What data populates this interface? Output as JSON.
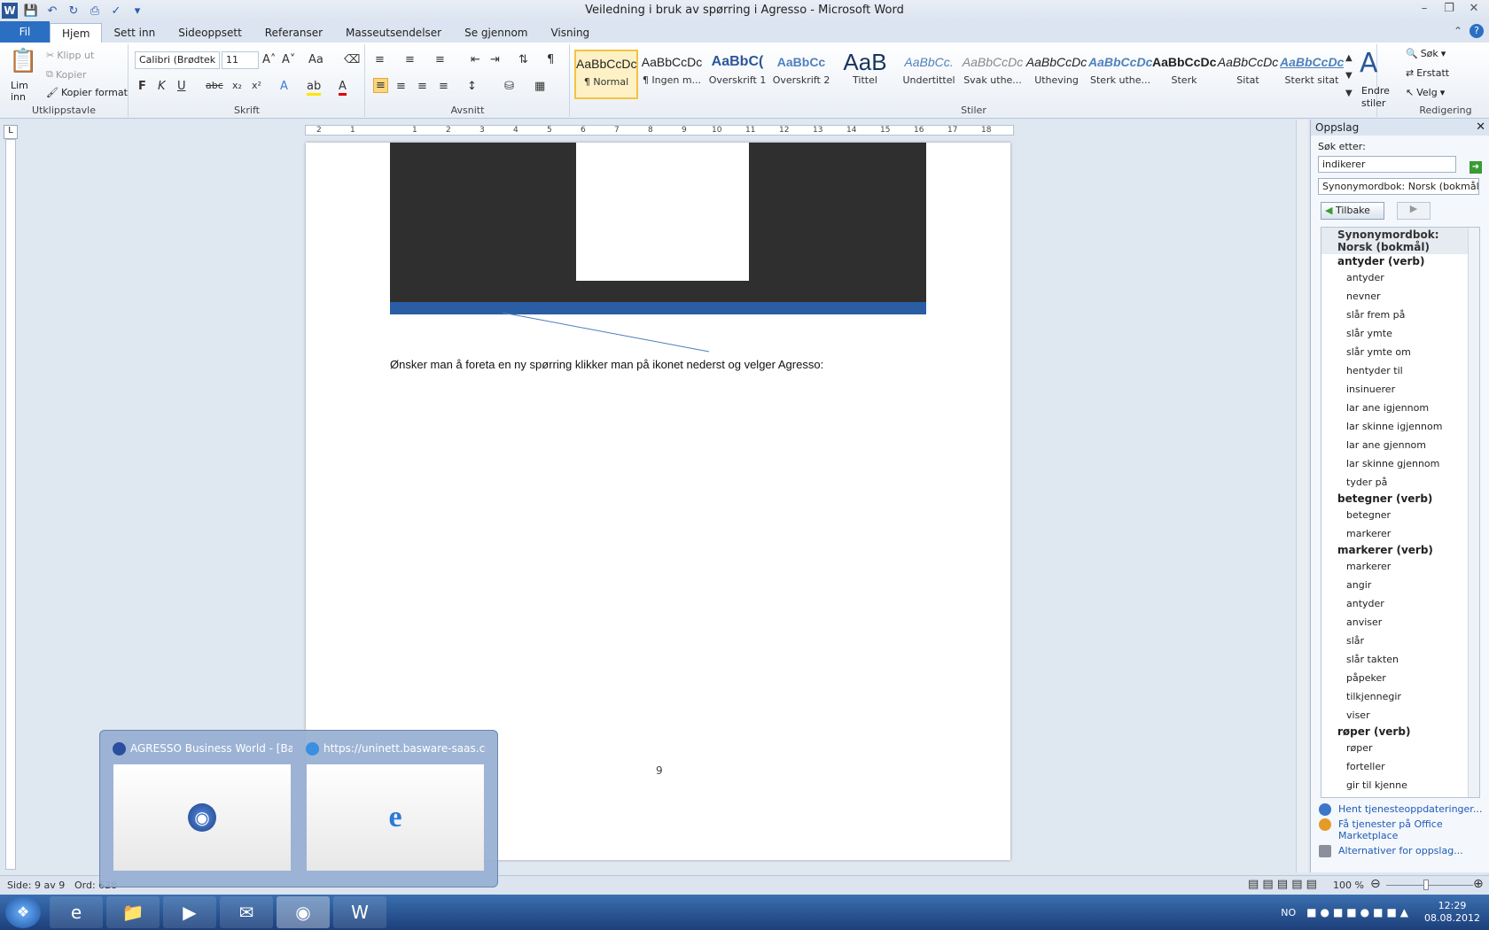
{
  "window": {
    "title": "Veiledning i bruk av spørring i Agresso  -  Microsoft Word",
    "logo": "W"
  },
  "tabs": [
    "Fil",
    "Hjem",
    "Sett inn",
    "Sideoppsett",
    "Referanser",
    "Masseutsendelser",
    "Se gjennom",
    "Visning"
  ],
  "ribbon": {
    "clipboard": {
      "label": "Utklippstavle",
      "paste": "Lim",
      "paste2": "inn",
      "cut": "Klipp ut",
      "copy": "Kopier",
      "format_painter": "Kopier format"
    },
    "font": {
      "label": "Skrift",
      "family": "Calibri (Brødtek",
      "size": "11"
    },
    "paragraph": {
      "label": "Avsnitt"
    },
    "styles": {
      "label": "Stiler",
      "items": [
        {
          "sample": "AaBbCcDc",
          "name": "¶ Normal"
        },
        {
          "sample": "AaBbCcDc",
          "name": "¶ Ingen m..."
        },
        {
          "sample": "AaBbC(",
          "name": "Overskrift 1"
        },
        {
          "sample": "AaBbCc",
          "name": "Overskrift 2"
        },
        {
          "sample": "AaB",
          "name": "Tittel"
        },
        {
          "sample": "AaBbCc.",
          "name": "Undertittel"
        },
        {
          "sample": "AaBbCcDc",
          "name": "Svak uthe..."
        },
        {
          "sample": "AaBbCcDc",
          "name": "Utheving"
        },
        {
          "sample": "AaBbCcDc",
          "name": "Sterk uthe..."
        },
        {
          "sample": "AaBbCcDc",
          "name": "Sterk"
        },
        {
          "sample": "AaBbCcDc",
          "name": "Sitat"
        },
        {
          "sample": "AaBbCcDc",
          "name": "Sterkt sitat"
        }
      ],
      "change": "Endre",
      "change2": "stiler"
    },
    "editing": {
      "label": "Redigering",
      "find": "Søk",
      "replace": "Erstatt",
      "select": "Velg"
    }
  },
  "document": {
    "body_text": "Ønsker man å foreta en ny spørring klikker man på ikonet nederst og velger Agresso:",
    "page_number": "9"
  },
  "pane": {
    "title": "Oppslag",
    "search_label": "Søk etter:",
    "search_value": "indikerer",
    "source": "Synonymordbok: Norsk (bokmål)",
    "back": "Tilbake",
    "root": "Synonymordbok: Norsk (bokmål)",
    "groups": [
      {
        "head": "antyder (verb)",
        "items": [
          "antyder",
          "nevner",
          "slår frem på",
          "slår ymte",
          "slår ymte om",
          "hentyder til",
          "insinuerer",
          "lar ane igjennom",
          "lar skinne igjennom",
          "lar ane gjennom",
          "lar skinne gjennom",
          "tyder på"
        ]
      },
      {
        "head": "betegner (verb)",
        "items": [
          "betegner",
          "markerer"
        ]
      },
      {
        "head": "markerer (verb)",
        "items": [
          "markerer",
          "angir",
          "antyder",
          "anviser",
          "slår",
          "slår takten",
          "påpeker",
          "tilkjennegir",
          "viser"
        ]
      },
      {
        "head": "røper (verb)",
        "items": [
          "røper",
          "forteller",
          "gir til kjenne"
        ]
      }
    ],
    "links": [
      "Hent tjenesteoppdateringer...",
      "Få tjenester på Office Marketplace",
      "Alternativer for oppslag..."
    ]
  },
  "status": {
    "page": "Side: 9 av 9",
    "words": "Ord: 628",
    "zoom": "100 %"
  },
  "taskbar": {
    "lang": "NO",
    "time": "12:29",
    "date": "08.08.2012"
  },
  "preview": {
    "items": [
      {
        "title": "AGRESSO Business World - [Ball..."
      },
      {
        "title": "https://uninett.basware-saas.co..."
      }
    ]
  }
}
